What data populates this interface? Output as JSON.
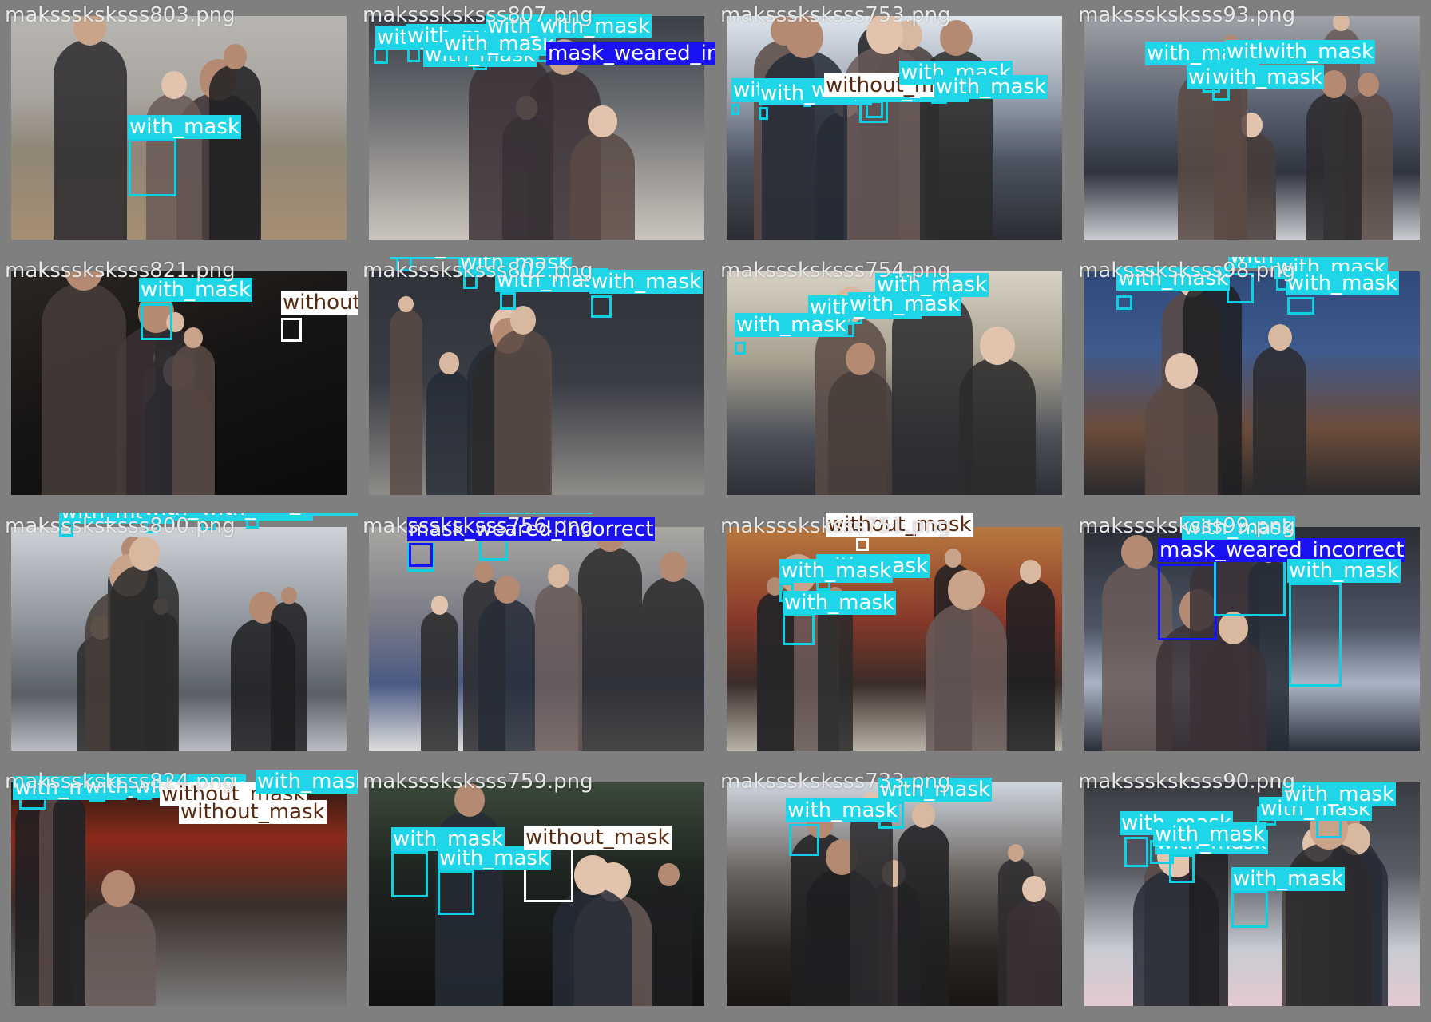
{
  "classes": {
    "with_mask": {
      "label": "with_mask",
      "color": "#1fd6e8",
      "text_color": "#ffffff"
    },
    "without_mask": {
      "label": "without_mask",
      "color": "#ffffff",
      "text_color": "#5a2a10"
    },
    "mask_weared_incorrect": {
      "label": "mask_weared_incorrect",
      "color": "#1a12f0",
      "text_color": "#ffffff"
    }
  },
  "tiles": [
    {
      "filename": "maksssksksss803.png",
      "scene": "hazy-city-street",
      "detections": [
        {
          "cls": "with_mask",
          "label": "with_mask"
        }
      ]
    },
    {
      "filename": "maksssksksss807.png",
      "scene": "crowd-indoor",
      "detections": [
        {
          "cls": "with_mask",
          "label": "with_mask"
        },
        {
          "cls": "with_mask",
          "label": "with_mask"
        },
        {
          "cls": "with_mask",
          "label": "with_mask"
        },
        {
          "cls": "with_mask",
          "label": "with_mask"
        },
        {
          "cls": "with_mask",
          "label": "with_mask"
        },
        {
          "cls": "with_mask",
          "label": "with_mask"
        },
        {
          "cls": "mask_weared_incorrect",
          "label": "mask_weared_incorrect"
        }
      ]
    },
    {
      "filename": "maksssksksss753.png",
      "scene": "scooters-street",
      "detections": [
        {
          "cls": "with_mask",
          "label": "with_mask"
        },
        {
          "cls": "with_mask",
          "label": "with_mask"
        },
        {
          "cls": "with_mask",
          "label": "with_mask"
        },
        {
          "cls": "with_mask",
          "label": "with_mask"
        },
        {
          "cls": "with_mask",
          "label": "with_mask"
        },
        {
          "cls": "without_mask",
          "label": "without_mask"
        },
        {
          "cls": "with_mask",
          "label": "with_mask"
        },
        {
          "cls": "with_mask",
          "label": "with_mask"
        }
      ]
    },
    {
      "filename": "maksssksksss93.png",
      "scene": "crosswalk",
      "detections": [
        {
          "cls": "with_mask",
          "label": "with_mask"
        },
        {
          "cls": "with_mask",
          "label": "with_mask"
        },
        {
          "cls": "with_mask",
          "label": "with_mask"
        },
        {
          "cls": "with_mask",
          "label": "with_mask"
        },
        {
          "cls": "with_mask",
          "label": "with_mask"
        }
      ]
    },
    {
      "filename": "maksssksksss821.png",
      "scene": "dark-tunnel",
      "detections": [
        {
          "cls": "with_mask",
          "label": "with_mask"
        },
        {
          "cls": "without_mask",
          "label": "without_mask"
        }
      ]
    },
    {
      "filename": "maksssksksss802.png",
      "scene": "seated-crowd",
      "detections": [
        {
          "cls": "with_mask",
          "label": "with_mask"
        },
        {
          "cls": "with_mask",
          "label": "with_mask"
        },
        {
          "cls": "with_mask",
          "label": "with_mask"
        },
        {
          "cls": "with_mask",
          "label": "with_mask"
        }
      ]
    },
    {
      "filename": "maksssksksss754.png",
      "scene": "phone-store",
      "detections": [
        {
          "cls": "with_mask",
          "label": "with_mask"
        },
        {
          "cls": "with_mask",
          "label": "with_mask"
        },
        {
          "cls": "with_mask",
          "label": "with_mask"
        },
        {
          "cls": "with_mask",
          "label": "with_mask"
        }
      ]
    },
    {
      "filename": "maksssksksss98.png",
      "scene": "train-station",
      "detections": [
        {
          "cls": "with_mask",
          "label": "with_mask"
        },
        {
          "cls": "with_mask",
          "label": "with_mask"
        },
        {
          "cls": "with_mask",
          "label": "with_mask"
        },
        {
          "cls": "with_mask",
          "label": "with_mask"
        }
      ]
    },
    {
      "filename": "maksssksksss800.png",
      "scene": "bicycles-fence",
      "detections": [
        {
          "cls": "with_mask",
          "label": "with_mask"
        },
        {
          "cls": "with_mask",
          "label": "with_mask"
        },
        {
          "cls": "with_mask",
          "label": "with_mask"
        },
        {
          "cls": "with_mask",
          "label": "with_mask"
        }
      ]
    },
    {
      "filename": "maksssksksss756.png",
      "scene": "walking-women",
      "detections": [
        {
          "cls": "with_mask",
          "label": "with_mask"
        },
        {
          "cls": "mask_weared_incorrect",
          "label": "mask_weared_incorrect"
        },
        {
          "cls": "with_mask",
          "label": "with_mask"
        }
      ]
    },
    {
      "filename": "maksssksksss751.png",
      "scene": "red-stool",
      "detections": [
        {
          "cls": "without_mask",
          "label": "without_mask"
        },
        {
          "cls": "with_mask",
          "label": "with_mask"
        },
        {
          "cls": "with_mask",
          "label": "with_mask"
        },
        {
          "cls": "with_mask",
          "label": "with_mask"
        }
      ]
    },
    {
      "filename": "maksssksksss99.png",
      "scene": "press-interview",
      "detections": [
        {
          "cls": "mask_weared_incorrect",
          "label": "mask_weared_incorrect"
        },
        {
          "cls": "with_mask",
          "label": "with_mask"
        },
        {
          "cls": "with_mask",
          "label": "with_mask"
        }
      ]
    },
    {
      "filename": "maksssksksss824.png",
      "scene": "neon-street",
      "detections": [
        {
          "cls": "with_mask",
          "label": "with_mask"
        },
        {
          "cls": "with_mask",
          "label": "with_mask"
        },
        {
          "cls": "with_mask",
          "label": "with_mask"
        },
        {
          "cls": "without_mask",
          "label": "without_mask"
        },
        {
          "cls": "without_mask",
          "label": "without_mask"
        },
        {
          "cls": "with_mask",
          "label": "with_mask"
        }
      ]
    },
    {
      "filename": "maksssksksss759.png",
      "scene": "group-portrait",
      "detections": [
        {
          "cls": "with_mask",
          "label": "with_mask"
        },
        {
          "cls": "with_mask",
          "label": "with_mask"
        },
        {
          "cls": "without_mask",
          "label": "without_mask"
        }
      ]
    },
    {
      "filename": "maksssksksss733.png",
      "scene": "narrow-alley",
      "detections": [
        {
          "cls": "with_mask",
          "label": "with_mask"
        },
        {
          "cls": "with_mask",
          "label": "with_mask"
        }
      ]
    },
    {
      "filename": "maksssksksss90.png",
      "scene": "temperature-check",
      "detections": [
        {
          "cls": "with_mask",
          "label": "with_mask"
        },
        {
          "cls": "with_mask",
          "label": "with_mask"
        },
        {
          "cls": "with_mask",
          "label": "with_mask"
        },
        {
          "cls": "with_mask",
          "label": "with_mask"
        },
        {
          "cls": "with_mask",
          "label": "with_mask"
        },
        {
          "cls": "with_mask",
          "label": "with_mask"
        }
      ]
    }
  ]
}
